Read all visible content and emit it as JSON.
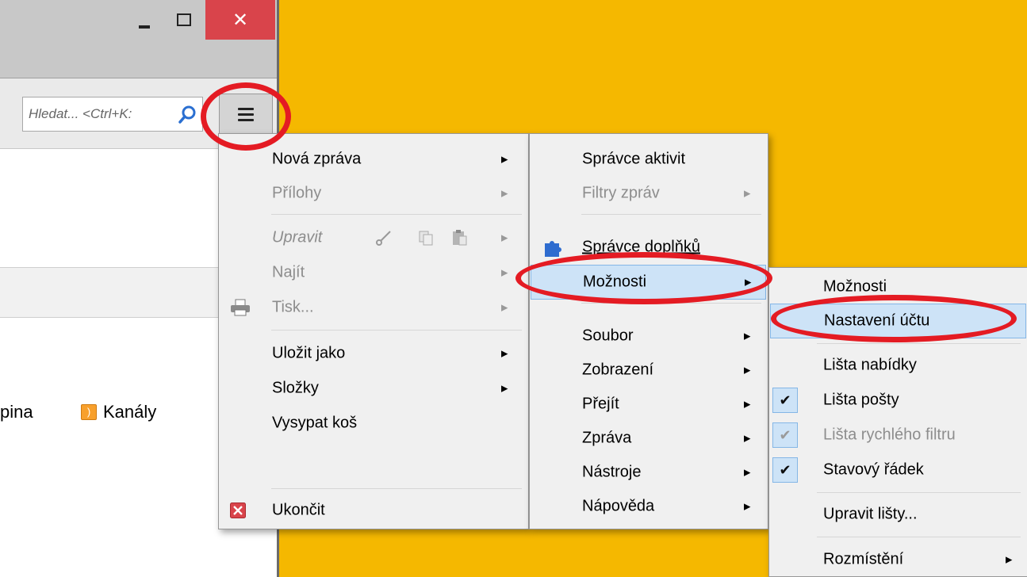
{
  "window": {
    "close_glyph": "✕",
    "search": {
      "placeholder": "Hledat... <Ctrl+K:"
    }
  },
  "background": {
    "fragment_text": "pina",
    "feeds_label": "Kanály"
  },
  "main_menu": {
    "items": [
      {
        "label": "Nová zpráva",
        "submenu": true
      },
      {
        "label": "Přílohy",
        "disabled": true,
        "submenu": true
      },
      {
        "label": "Upravit",
        "disabled": true,
        "submenu": true
      },
      {
        "label": "Najít",
        "disabled": true,
        "submenu": true
      },
      {
        "label": "Tisk...",
        "disabled": true,
        "submenu": true
      },
      {
        "label": "Uložit jako",
        "submenu": true
      },
      {
        "label": "Složky",
        "submenu": true
      },
      {
        "label": "Vysypat koš"
      },
      {
        "label": "Ukončit"
      }
    ]
  },
  "tools_menu": {
    "items": [
      {
        "label": "Správce aktivit"
      },
      {
        "label": "Filtry zpráv",
        "disabled": true,
        "submenu": true
      },
      {
        "label": "Správce doplňků"
      },
      {
        "label": "Možnosti",
        "submenu": true,
        "highlighted": true
      },
      {
        "label": "Soubor",
        "submenu": true
      },
      {
        "label": "Zobrazení",
        "submenu": true
      },
      {
        "label": "Přejít",
        "submenu": true
      },
      {
        "label": "Zpráva",
        "submenu": true
      },
      {
        "label": "Nástroje",
        "submenu": true
      },
      {
        "label": "Nápověda",
        "submenu": true
      }
    ]
  },
  "options_menu": {
    "items": [
      {
        "label": "Možnosti"
      },
      {
        "label": "Nastavení účtu",
        "highlighted": true
      },
      {
        "label": "Lišta nabídky"
      },
      {
        "label": "Lišta pošty",
        "checked": true
      },
      {
        "label": "Lišta rychlého filtru",
        "checked": true,
        "disabled": true
      },
      {
        "label": "Stavový řádek",
        "checked": true
      },
      {
        "label": "Upravit lišty..."
      },
      {
        "label": "Rozmístění",
        "submenu": true
      }
    ]
  },
  "colors": {
    "background": "#f5b800",
    "highlight": "#cde3f7",
    "annotation_ring": "#e41b23",
    "close_button": "#d9444b"
  }
}
